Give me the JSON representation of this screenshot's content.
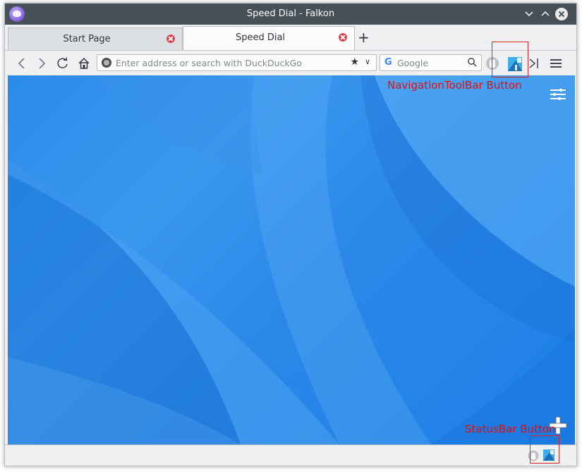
{
  "window": {
    "title": "Speed Dial - Falkon"
  },
  "tabs": [
    {
      "label": "Start Page",
      "active": false
    },
    {
      "label": "Speed Dial",
      "active": true
    }
  ],
  "new_tab_symbol": "+",
  "navigation": {
    "back_icon": "back-arrow-icon",
    "forward_icon": "forward-arrow-icon",
    "reload_icon": "reload-icon",
    "home_icon": "home-icon",
    "address_placeholder": "Enter address or search with DuckDuckGo",
    "search_engine_letter": "G",
    "search_placeholder": "Google"
  },
  "annotations": {
    "navigation_toolbar_label": "NavigationToolBar Button",
    "statusbar_label": "StatusBar Button",
    "color": "#e01010"
  },
  "colors": {
    "titlebar": "#475057",
    "content_blue": "#2a8cea",
    "tab_close": "#da4453"
  }
}
